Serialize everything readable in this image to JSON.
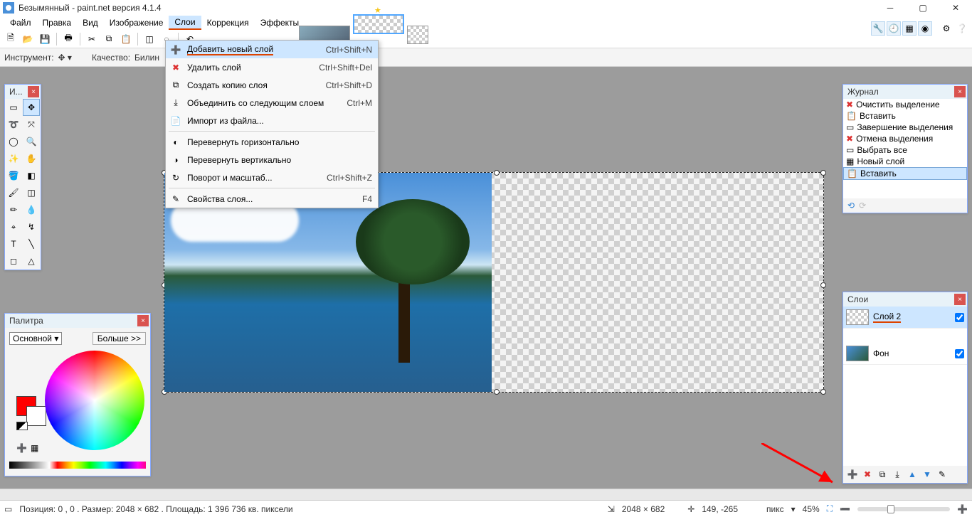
{
  "title": "Безымянный - paint.net версия 4.1.4",
  "menu": {
    "file": "Файл",
    "edit": "Правка",
    "view": "Вид",
    "image": "Изображение",
    "layers": "Слои",
    "adjust": "Коррекция",
    "effects": "Эффекты"
  },
  "layers_menu": [
    {
      "icon": "➕",
      "label": "Добавить новый слой",
      "shortcut": "Ctrl+Shift+N",
      "hl": true
    },
    {
      "icon": "✖",
      "iconColor": "#d33",
      "label": "Удалить слой",
      "shortcut": "Ctrl+Shift+Del"
    },
    {
      "icon": "⧉",
      "label": "Создать копию слоя",
      "shortcut": "Ctrl+Shift+D"
    },
    {
      "icon": "⤓",
      "label": "Объединить со следующим слоем",
      "shortcut": "Ctrl+M"
    },
    {
      "icon": "📄",
      "label": "Импорт из файла..."
    },
    {
      "sep": true
    },
    {
      "icon": "◐",
      "label": "Перевернуть горизонтально"
    },
    {
      "icon": "◑",
      "label": "Перевернуть вертикально"
    },
    {
      "icon": "↻",
      "label": "Поворот и масштаб...",
      "shortcut": "Ctrl+Shift+Z"
    },
    {
      "sep": true
    },
    {
      "icon": "✎",
      "label": "Свойства слоя...",
      "shortcut": "F4"
    }
  ],
  "toolrow2": {
    "instrument_label": "Инструмент:",
    "quality_label": "Качество:",
    "quality_value": "Билин"
  },
  "tools_panel_title": "И...",
  "palette": {
    "title": "Палитра",
    "channel": "Основной",
    "more": "Больше >>"
  },
  "history": {
    "title": "Журнал",
    "items": [
      {
        "icon": "✖",
        "color": "#d33",
        "label": "Очистить выделение"
      },
      {
        "icon": "📋",
        "label": "Вставить"
      },
      {
        "icon": "▭",
        "label": "Завершение выделения"
      },
      {
        "icon": "✖",
        "color": "#d33",
        "label": "Отмена выделения"
      },
      {
        "icon": "▭",
        "label": "Выбрать все"
      },
      {
        "icon": "▦",
        "label": "Новый слой"
      },
      {
        "icon": "📋",
        "label": "Вставить",
        "active": true
      }
    ]
  },
  "layers": {
    "title": "Слои",
    "items": [
      {
        "name": "Слой 2",
        "checked": true,
        "selected": true,
        "underline": true
      },
      {
        "name": "Фон",
        "checked": true
      }
    ]
  },
  "status": {
    "pos": "Позиция: 0 , 0 . Размер: 2048  × 682 . Площадь: 1 396 736 кв. пиксели",
    "dims": "2048 × 682",
    "cursor": "149, -265",
    "unit": "пикс",
    "zoom": "45%"
  }
}
